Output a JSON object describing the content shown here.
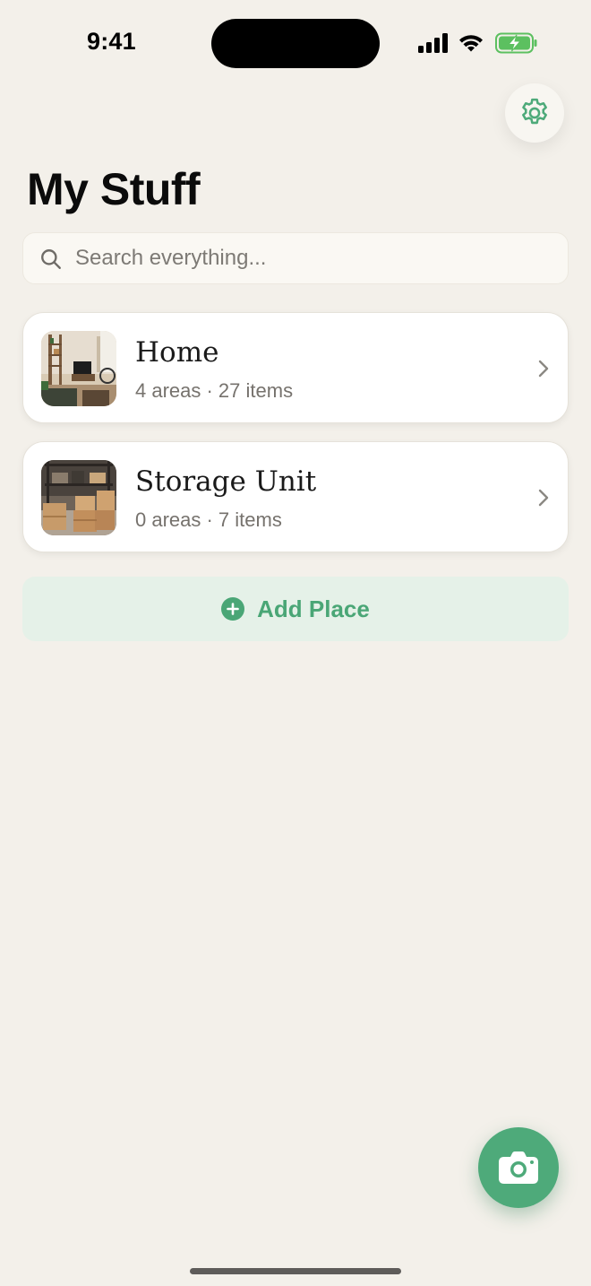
{
  "status_bar": {
    "time": "9:41"
  },
  "header": {
    "title": "My Stuff",
    "settings_icon": "gear-icon"
  },
  "search": {
    "placeholder": "Search everything...",
    "value": ""
  },
  "places": [
    {
      "name": "Home",
      "meta": "4 areas · 27 items",
      "thumbnail": "living-room-photo"
    },
    {
      "name": "Storage Unit",
      "meta": "0 areas · 7 items",
      "thumbnail": "storage-boxes-photo"
    }
  ],
  "add_place": {
    "label": "Add Place",
    "icon": "plus-circle-icon"
  },
  "fab": {
    "icon": "camera-icon"
  },
  "colors": {
    "background": "#f3f0ea",
    "accent": "#4eaa7a",
    "accent_soft": "#e5f1e8",
    "card": "#ffffff",
    "battery": "#5cc060"
  }
}
